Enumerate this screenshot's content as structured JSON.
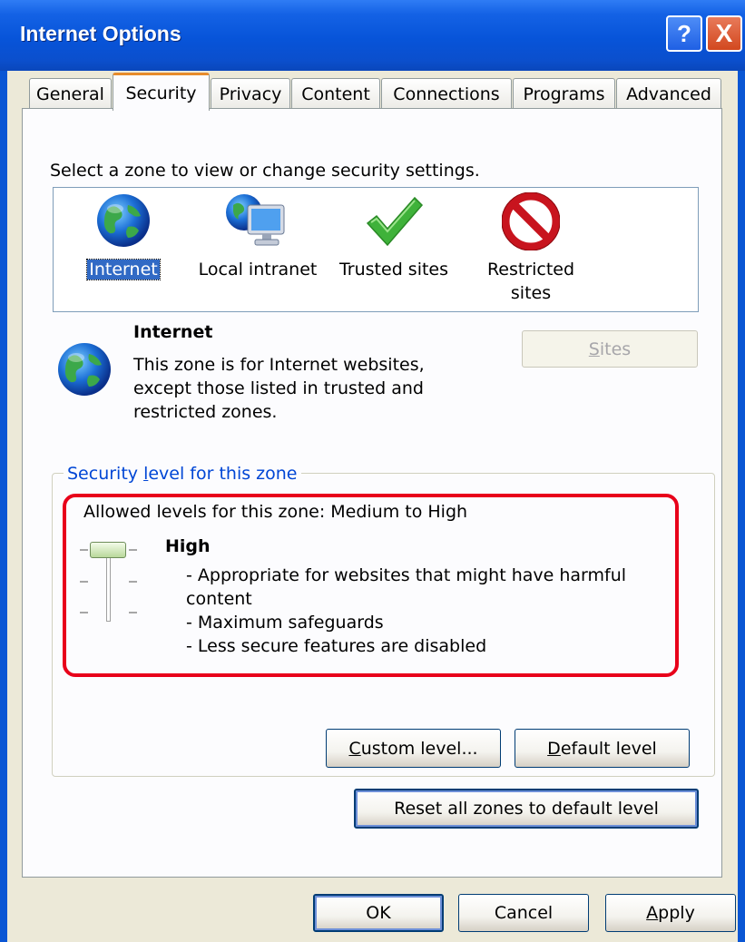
{
  "window": {
    "title": "Internet Options",
    "help_label": "?",
    "close_label": "X"
  },
  "tabs": [
    {
      "label": "General"
    },
    {
      "label": "Security",
      "active": true
    },
    {
      "label": "Privacy"
    },
    {
      "label": "Content"
    },
    {
      "label": "Connections"
    },
    {
      "label": "Programs"
    },
    {
      "label": "Advanced"
    }
  ],
  "zones": {
    "prompt": "Select a zone to view or change security settings.",
    "items": [
      {
        "label": "Internet",
        "icon": "globe-icon",
        "selected": true
      },
      {
        "label": "Local intranet",
        "icon": "intranet-icon"
      },
      {
        "label": "Trusted sites",
        "icon": "checkmark-icon"
      },
      {
        "label_line1": "Restricted",
        "label_line2": "sites",
        "icon": "restricted-icon"
      }
    ]
  },
  "selected_zone": {
    "title": "Internet",
    "desc_line1": "This zone is for Internet websites,",
    "desc_line2": "except those listed in trusted and",
    "desc_line3": "restricted zones.",
    "sites_button": {
      "prefix": "",
      "accel": "S",
      "rest": "ites",
      "enabled": false
    }
  },
  "security_level": {
    "group_title_prefix": "Security ",
    "group_title_accel": "l",
    "group_title_rest": "evel for this zone",
    "allowed": "Allowed levels for this zone: Medium to High",
    "level_name": "High",
    "desc_line1": "- Appropriate for websites that might have harmful",
    "desc_line2": "content",
    "desc_line3": "- Maximum safeguards",
    "desc_line4": "- Less secure features are disabled",
    "slider_level": "High",
    "custom_button": {
      "accel": "C",
      "rest": "ustom level..."
    },
    "default_button": {
      "accel": "D",
      "rest": "efault level"
    }
  },
  "reset_button": "Reset all zones to default level",
  "footer": {
    "ok": "OK",
    "cancel": "Cancel",
    "apply_accel": "A",
    "apply_rest": "pply"
  },
  "colors": {
    "titlebar": "#0754d9",
    "active_tab_accent": "#e68b2c",
    "highlight_box": "#e8001a",
    "selection": "#316ac5",
    "group_title": "#0046d5"
  }
}
